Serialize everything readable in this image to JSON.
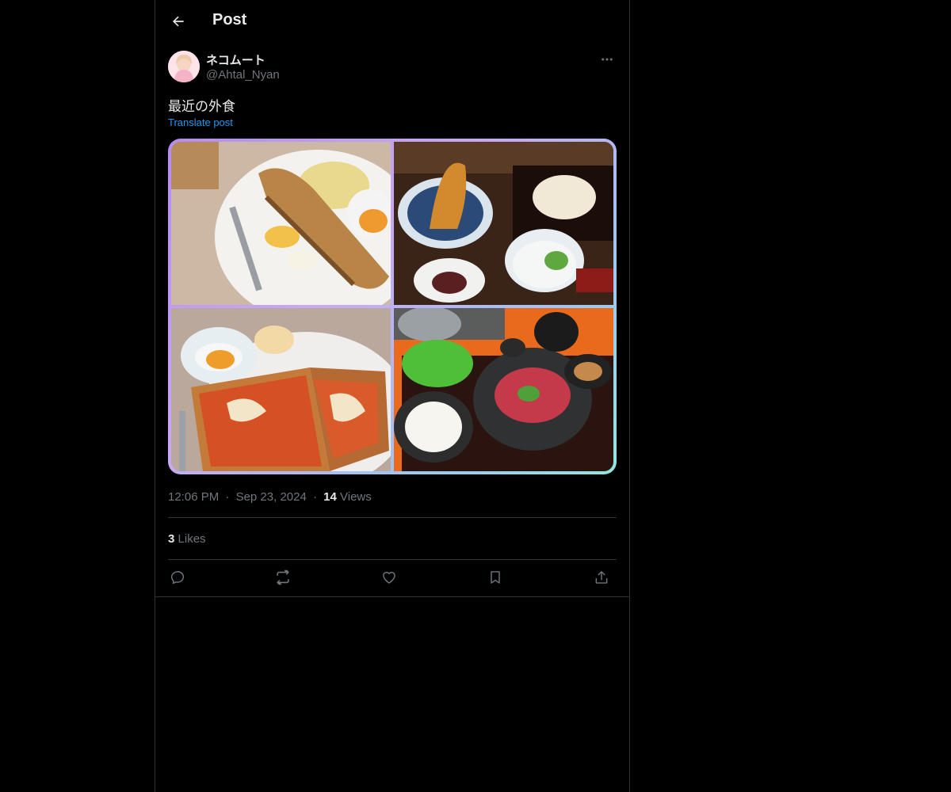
{
  "header": {
    "title": "Post",
    "back_icon": "arrow-left-icon"
  },
  "author": {
    "display_name": "ネコムート",
    "handle": "@Ahtal_Nyan",
    "avatar_icon": "avatar-image",
    "more_icon": "more-horizontal-icon"
  },
  "post": {
    "text": "最近の外食",
    "translate_label": "Translate post",
    "media_count": 4
  },
  "meta": {
    "time": "12:06 PM",
    "separator": "·",
    "date": "Sep 23, 2024",
    "views_count": "14",
    "views_label": "Views"
  },
  "stats": {
    "likes_count": "3",
    "likes_label": "Likes"
  },
  "actions": {
    "icons": [
      "reply-icon",
      "repost-icon",
      "like-icon",
      "bookmark-icon",
      "share-icon"
    ]
  },
  "colors": {
    "background": "#000000",
    "text": "#e7e9ea",
    "secondary_text": "#71767b",
    "link": "#1d9bf0",
    "divider": "#2f3336"
  }
}
